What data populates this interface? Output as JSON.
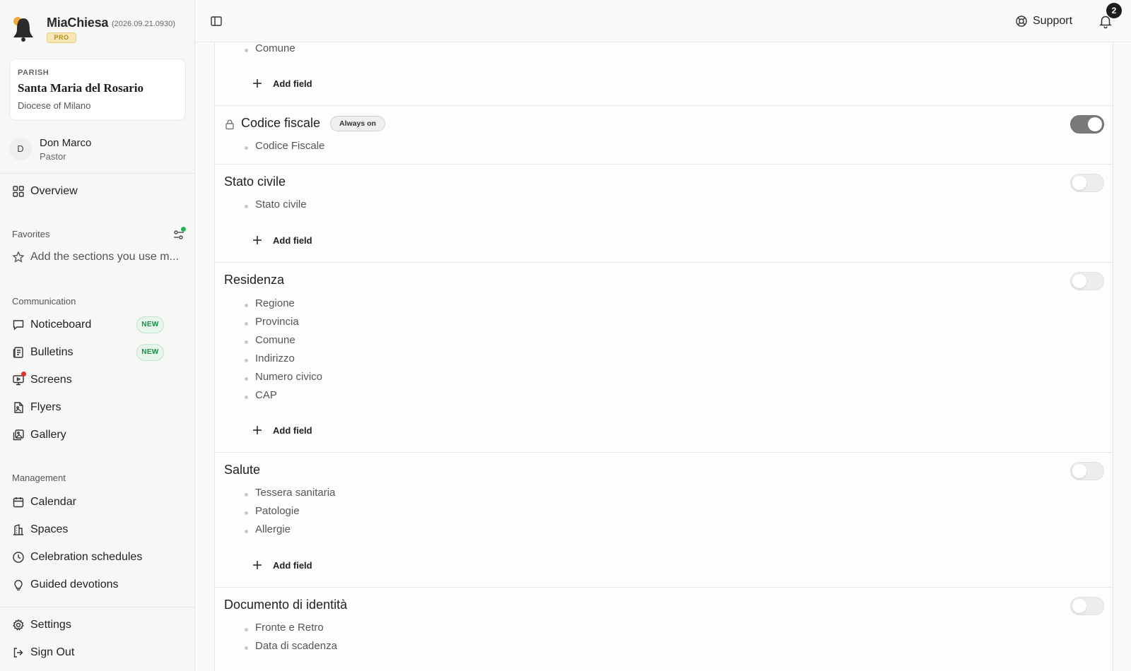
{
  "app": {
    "name": "MiaChiesa",
    "version": "(2026.09.21.0930)",
    "plan_badge": "PRO"
  },
  "parish": {
    "kicker": "PARISH",
    "name": "Santa Maria del Rosario",
    "diocese": "Diocese of Milano"
  },
  "user": {
    "initial": "D",
    "name": "Don Marco",
    "role": "Pastor"
  },
  "nav": {
    "overview": "Overview",
    "favorites_title": "Favorites",
    "favorites_hint": "Add the sections you use m...",
    "communication_title": "Communication",
    "communication": [
      {
        "label": "Noticeboard",
        "badge": "NEW",
        "icon": "message-square-icon"
      },
      {
        "label": "Bulletins",
        "badge": "NEW",
        "icon": "newspaper-icon"
      },
      {
        "label": "Screens",
        "icon": "monitor-icon"
      },
      {
        "label": "Flyers",
        "icon": "file-image-icon"
      },
      {
        "label": "Gallery",
        "icon": "images-icon"
      }
    ],
    "management_title": "Management",
    "management": [
      {
        "label": "Calendar",
        "icon": "calendar-icon"
      },
      {
        "label": "Spaces",
        "icon": "building-icon"
      },
      {
        "label": "Celebration schedules",
        "icon": "clock-icon"
      },
      {
        "label": "Guided devotions",
        "icon": "lightbulb-icon"
      }
    ],
    "settings": "Settings",
    "sign_out": "Sign Out"
  },
  "topbar": {
    "support": "Support",
    "notification_count": "2"
  },
  "main": {
    "add_field_label": "Add field",
    "always_on_label": "Always on",
    "groups": [
      {
        "title": "",
        "fields": [
          "Comune"
        ],
        "enabled": null
      },
      {
        "title": "Codice fiscale",
        "locked": true,
        "fields": [
          "Codice Fiscale"
        ],
        "enabled": true
      },
      {
        "title": "Stato civile",
        "fields": [
          "Stato civile"
        ],
        "enabled": false
      },
      {
        "title": "Residenza",
        "fields": [
          "Regione",
          "Provincia",
          "Comune",
          "Indirizzo",
          "Numero civico",
          "CAP"
        ],
        "enabled": false
      },
      {
        "title": "Salute",
        "fields": [
          "Tessera sanitaria",
          "Patologie",
          "Allergie"
        ],
        "enabled": false
      },
      {
        "title": "Documento di identità",
        "fields": [
          "Fronte e Retro",
          "Data di scadenza"
        ],
        "enabled": false
      }
    ]
  }
}
